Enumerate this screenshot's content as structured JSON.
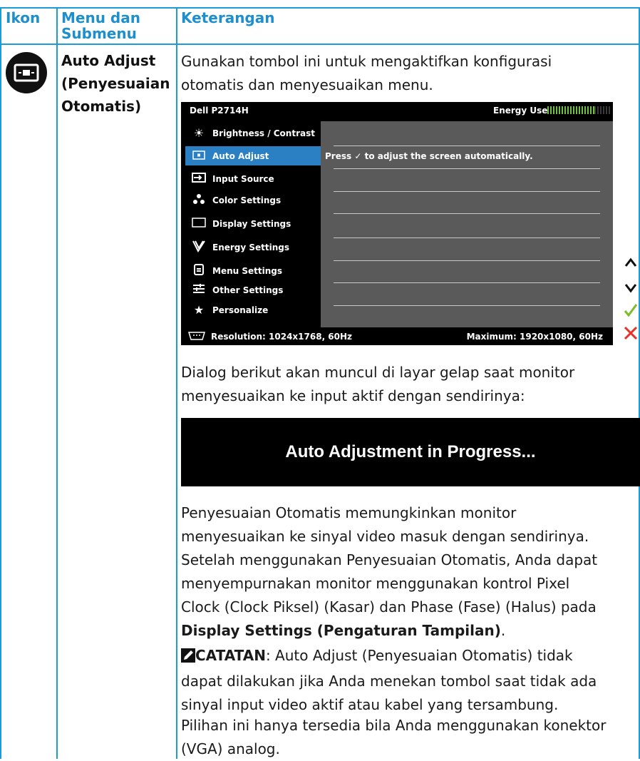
{
  "table": {
    "headers": [
      "Ikon",
      "Menu dan Submenu",
      "Keterangan"
    ],
    "header_menu_line1": "Menu dan",
    "header_menu_line2": "Submenu",
    "row": {
      "menu_line1": "Auto Adjust",
      "menu_line2": "(Penyesuaian",
      "menu_line3": "Otomatis)",
      "intro_line1": "Gunakan tombol ini untuk mengaktifkan konfigurasi",
      "intro_line2": "otomatis dan menyesuaikan menu."
    }
  },
  "osd": {
    "model": "Dell P2714H",
    "energy_label": "Energy Use",
    "menu_items": [
      {
        "label": "Brightness / Contrast",
        "icon": "brightness-icon"
      },
      {
        "label": "Auto Adjust",
        "icon": "auto-adjust-icon",
        "active": true
      },
      {
        "label": "Input Source",
        "icon": "input-source-icon"
      },
      {
        "label": "Color Settings",
        "icon": "color-settings-icon"
      },
      {
        "label": "Display Settings",
        "icon": "display-settings-icon"
      },
      {
        "label": "Energy Settings",
        "icon": "energy-settings-icon"
      },
      {
        "label": "Menu Settings",
        "icon": "menu-settings-icon"
      },
      {
        "label": "Other Settings",
        "icon": "other-settings-icon"
      },
      {
        "label": "Personalize",
        "icon": "star-icon"
      }
    ],
    "hint_prefix": "Press",
    "hint_suffix": "to adjust the screen automatically.",
    "resolution": "Resolution: 1024x1768, 60Hz",
    "maximum": "Maximum: 1920x1080, 60Hz",
    "side_buttons": [
      "up-arrow-icon",
      "down-arrow-icon",
      "check-icon",
      "close-icon"
    ]
  },
  "dialog_intro_line1": "Dialog berikut akan muncul di layar gelap saat monitor",
  "dialog_intro_line2": "menyesuaikan ke input aktif dengan sendirinya:",
  "progress_text": "Auto Adjustment in Progress...",
  "para1": [
    "Penyesuaian Otomatis memungkinkan monitor",
    "menyesuaikan ke sinyal video masuk dengan sendirinya.",
    "Setelah menggunakan Penyesuaian Otomatis, Anda dapat",
    "menyempurnakan monitor menggunakan kontrol Pixel",
    "Clock (Clock Piksel) (Kasar) dan Phase (Fase) (Halus) pada"
  ],
  "para1_bold": "Display Settings (Pengaturan Tampilan)",
  "para1_end": ".",
  "note_label": "CATATAN",
  "note_text_line1": ": Auto Adjust (Penyesuaian Otomatis) tidak",
  "note_text_line2": "dapat dilakukan jika Anda menekan tombol saat tidak ada",
  "note_text_line3": "sinyal input video aktif atau kabel yang tersambung.",
  "final_line1": "Pilihan ini hanya tersedia bila Anda menggunakan konektor",
  "final_line2": "(VGA) analog."
}
